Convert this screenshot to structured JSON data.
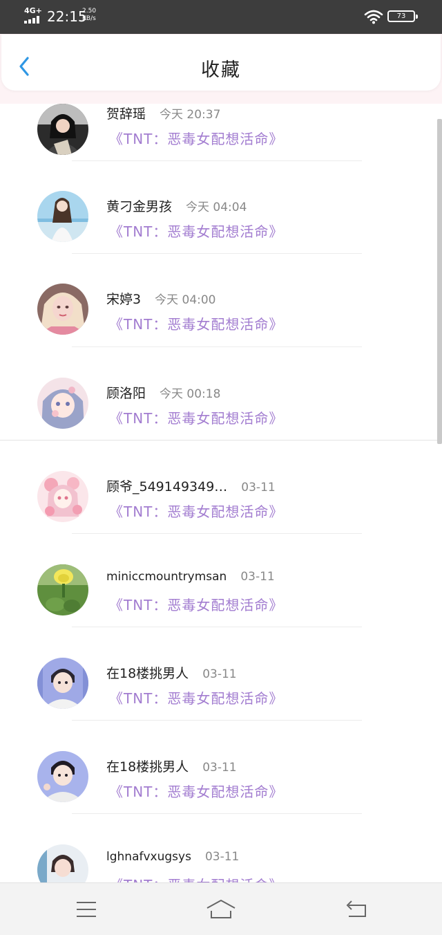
{
  "status_bar": {
    "network": "4G+",
    "time": "22:15",
    "speed_value": "2.50",
    "speed_unit": "KB/s",
    "battery": "73",
    "icons": [
      "signal-icon",
      "wifi-icon",
      "battery-icon"
    ]
  },
  "header": {
    "title": "收藏",
    "back_icon": "chevron-left-icon"
  },
  "colors": {
    "accent": "#2f97e4",
    "novel_text": "#a27cd0",
    "status_bar": "#3d3d3d"
  },
  "items": [
    {
      "name": "贺辞瑶",
      "time": "今天 20:37",
      "novel": "《TNT：恶毒女配想活命》"
    },
    {
      "name": "黄刁金男孩",
      "time": "今天 04:04",
      "novel": "《TNT：恶毒女配想活命》"
    },
    {
      "name": "宋婷3",
      "time": "今天 04:00",
      "novel": "《TNT：恶毒女配想活命》"
    },
    {
      "name": "顾洛阳",
      "time": "今天 00:18",
      "novel": "《TNT：恶毒女配想活命》"
    },
    {
      "name": "顾爷_549149349…",
      "time": "03-11",
      "novel": "《TNT：恶毒女配想活命》"
    },
    {
      "name": "miniccmountrymsan",
      "time": "03-11",
      "novel": "《TNT：恶毒女配想活命》"
    },
    {
      "name": "在18楼挑男人",
      "time": "03-11",
      "novel": "《TNT：恶毒女配想活命》"
    },
    {
      "name": "在18楼挑男人",
      "time": "03-11",
      "novel": "《TNT：恶毒女配想活命》"
    },
    {
      "name": "lghnafvxugsys",
      "time": "03-11",
      "novel": "《TNT：恶毒女配想活命》"
    }
  ],
  "nav": {
    "icons": [
      "menu-icon",
      "home-icon",
      "back-icon"
    ]
  }
}
